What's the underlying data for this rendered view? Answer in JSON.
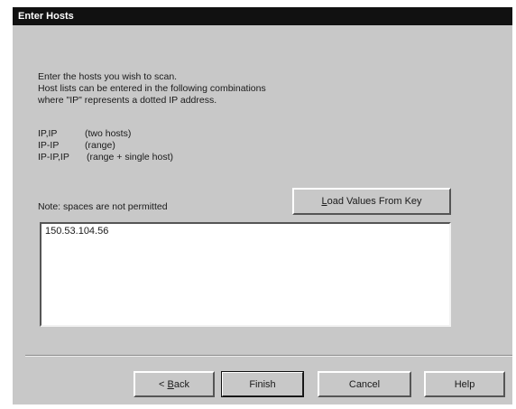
{
  "window": {
    "title": "Enter Hosts"
  },
  "instructions": {
    "line1": "Enter the hosts you wish to scan.",
    "line2": "Host lists can be entered in the following combinations",
    "line3": "where \"IP\" represents a dotted IP address."
  },
  "formats": [
    {
      "pattern": "IP,IP",
      "desc": "(two hosts)"
    },
    {
      "pattern": "IP-IP",
      "desc": "(range)"
    },
    {
      "pattern": "IP-IP,IP",
      "desc": "(range + single host)"
    }
  ],
  "note": "Note: spaces are not permitted",
  "load_button": {
    "label_prefix": "",
    "label_mnemonic": "L",
    "label_rest": "oad Values From Key"
  },
  "hosts_input": {
    "value": "150.53.104.56"
  },
  "buttons": {
    "back_prefix": "< ",
    "back_mnemonic": "B",
    "back_rest": "ack",
    "finish": "Finish",
    "cancel": "Cancel",
    "help": "Help"
  }
}
